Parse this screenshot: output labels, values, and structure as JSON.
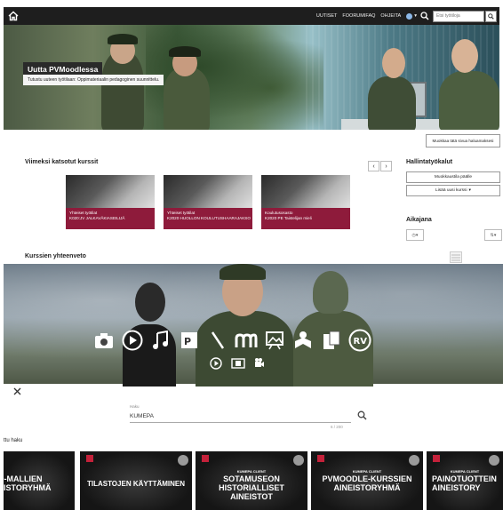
{
  "navbar": {
    "links": [
      "UUTISET",
      "FOORUMIFAQ",
      "OHJEITA"
    ],
    "search_placeholder": "Etsi työtiloja"
  },
  "hero": {
    "title": "Uutta PVMoodlessa",
    "subtitle": "Tutustu uuteen työtilaan: Oppimateriaalin pedagoginen suunnittelu."
  },
  "customize_label": "Muokkaa tätä sivua haluamaksesi",
  "recent": {
    "title": "Viimeksi katsotut kurssit",
    "courses": [
      {
        "category": "Yhteiset työtilat",
        "name": "K020:JV JALKAVÄKIASEILIJÄ"
      },
      {
        "category": "Yhteiset työtilat",
        "name": "K2020 HUOLLON KOULUTUSHAARAJAKSO"
      },
      {
        "category": "Koulutusosasto",
        "name": "K2020 PE Taistelijan mieli"
      }
    ]
  },
  "sidebar": {
    "admin_title": "Hallintatyökalut",
    "edit_on": "Muokkaustila päälle",
    "add_course": "Lisää uusi kurssi",
    "timeline_title": "Aikajana"
  },
  "overview": {
    "title": "Kurssien yhteenveto"
  },
  "search": {
    "label": "Haku",
    "value": "KUMEPA",
    "count": "6 / 200"
  },
  "results_label": "ttu haku",
  "tiles": [
    {
      "kicker": "",
      "title": "D-MALLIEN\nEISTORYHMÄ"
    },
    {
      "kicker": "",
      "title": "TILASTOJEN KÄYTTÄMINEN"
    },
    {
      "kicker": "KUMEPA CLIENT",
      "title": "SOTAMUSEON\nHISTORIALLISET\nAINEISTOT"
    },
    {
      "kicker": "KUMEPA CLIENT",
      "title": "PVMOODLE-KURSSIEN\nAINEISTORYHMÄ"
    },
    {
      "kicker": "KUMEPA CLIENT",
      "title": "PAINOTUOTTEIN\nAINEISTORY"
    }
  ],
  "colors": {
    "navbar": "#1e1e1e",
    "course_card": "#8e1b3b",
    "tile_badge": "#c4213a"
  }
}
